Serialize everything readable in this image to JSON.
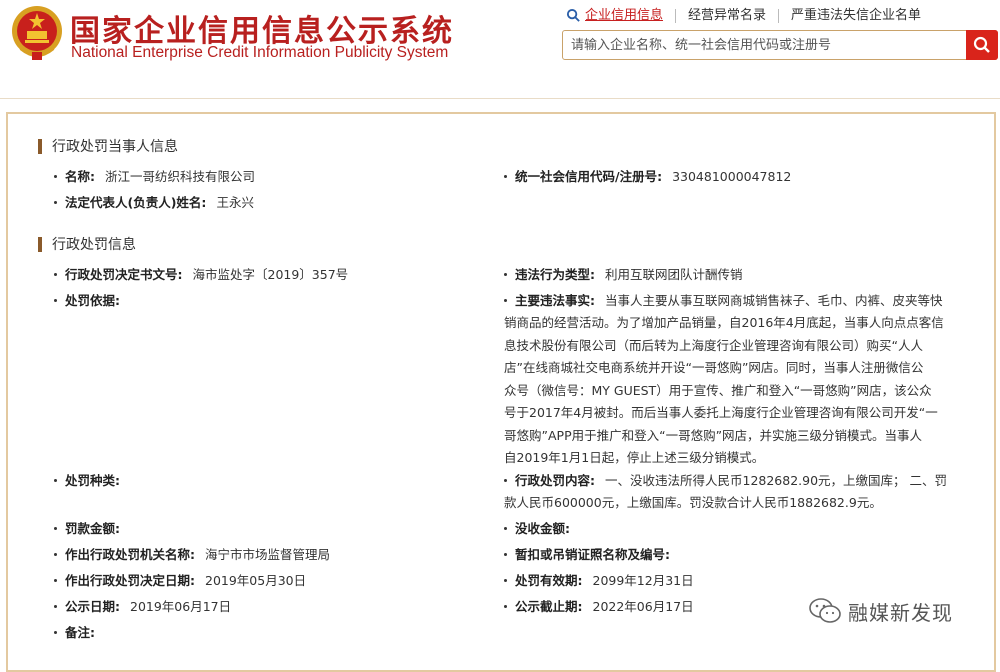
{
  "header": {
    "title_cn": "国家企业信用信息公示系统",
    "title_en": "National Enterprise Credit Information Publicity System",
    "links": [
      "企业信用信息",
      "经营异常名录",
      "严重违法失信企业名单"
    ],
    "search_placeholder": "请输入企业名称、统一社会信用代码或注册号",
    "brand_color": "#b8201f",
    "search_button_color": "#d9241b"
  },
  "party_section": {
    "title": "行政处罚当事人信息",
    "name_label": "名称:",
    "name_value": "浙江一哥纺织科技有限公司",
    "code_label": "统一社会信用代码/注册号:",
    "code_value": "330481000047812",
    "rep_label": "法定代表人(负责人)姓名:",
    "rep_value": "王永兴"
  },
  "penalty_section": {
    "title": "行政处罚信息",
    "doc_label": "行政处罚决定书文号:",
    "doc_value": "海市监处字〔2019〕357号",
    "type_label": "违法行为类型:",
    "type_value": "利用互联网团队计酬传销",
    "basis_label": "处罚依据:",
    "basis_value": "",
    "facts_label": "主要违法事实:",
    "facts_lines": [
      "当事人主要从事互联网商城销售袜子、毛巾、内裤、皮夹等快",
      "销商品的经营活动。为了增加产品销量，自2016年4月底起，当事人向点点客信",
      "息技术股份有限公司（而后转为上海度行企业管理咨询有限公司）购买“人人",
      "店”在线商城社交电商系统并开设“一哥悠购”网店。同时，当事人注册微信公",
      "众号（微信号：MY GUEST）用于宣传、推广和登入“一哥悠购”网店，该公众",
      "号于2017年4月被封。而后当事人委托上海度行企业管理咨询有限公司开发“一",
      "哥悠购”APP用于推广和登入“一哥悠购”网店，并实施三级分销模式。当事人",
      "自2019年1月1日起，停止上述三级分销模式。"
    ],
    "kind_label": "处罚种类:",
    "kind_value": "",
    "content_label": "行政处罚内容:",
    "content_lines": [
      "一、没收违法所得人民币1282682.90元，上缴国库；  二、罚",
      "款人民币600000元，上缴国库。罚没款合计人民币1882682.9元。"
    ],
    "fine_label": "罚款金额:",
    "fine_value": "",
    "confiscate_label": "没收金额:",
    "confiscate_value": "",
    "org_label": "作出行政处罚机关名称:",
    "org_value": "海宁市市场监督管理局",
    "license_label": "暂扣或吊销证照名称及编号:",
    "license_value": "",
    "decision_date_label": "作出行政处罚决定日期:",
    "decision_date_value": "2019年05月30日",
    "valid_label": "处罚有效期:",
    "valid_value": "2099年12月31日",
    "pub_date_label": "公示日期:",
    "pub_date_value": "2019年06月17日",
    "pub_end_label": "公示截止期:",
    "pub_end_value": "2022年06月17日",
    "remark_label": "备注:",
    "remark_value": ""
  },
  "watermark": {
    "text": "融媒新发现"
  }
}
